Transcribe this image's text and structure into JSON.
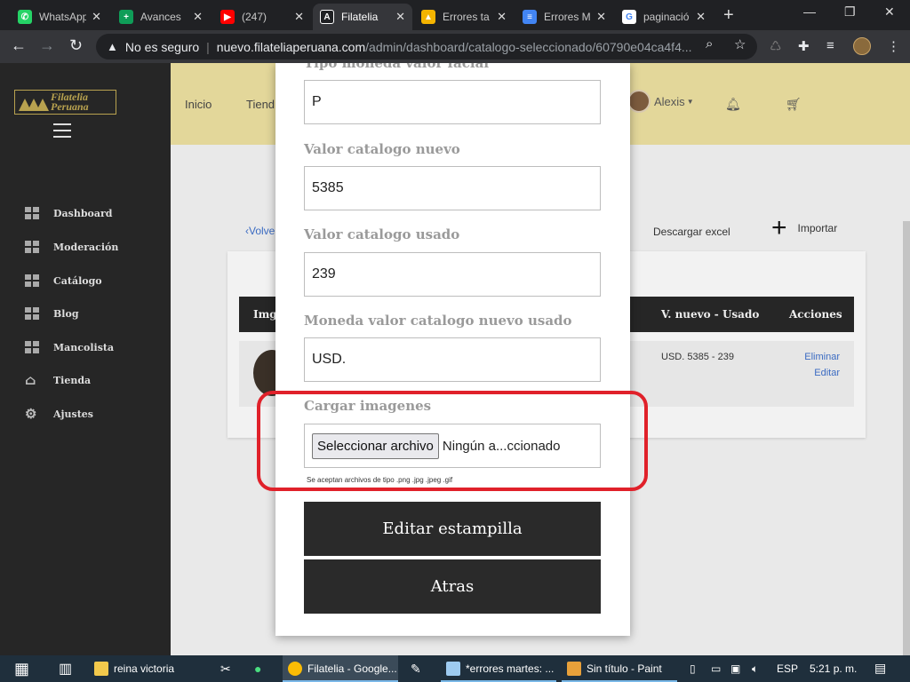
{
  "browser": {
    "tabs": [
      {
        "title": "WhatsApp",
        "favicon": "whatsapp-icon",
        "color": "#25d366"
      },
      {
        "title": "Avances",
        "favicon": "sheets-icon",
        "color": "#0f9d58"
      },
      {
        "title": "(247)",
        "favicon": "youtube-icon",
        "color": "#ff0000"
      },
      {
        "title": "Filatelia",
        "favicon": "site-a-icon",
        "color": "#202124"
      },
      {
        "title": "Errores ta",
        "favicon": "drive-icon",
        "color": "#f4b400"
      },
      {
        "title": "Errores M",
        "favicon": "docs-icon",
        "color": "#4285f4"
      },
      {
        "title": "paginació",
        "favicon": "google-icon",
        "color": "#4285f4"
      }
    ],
    "security_label": "No es seguro",
    "url_host": "nuevo.filateliaperuana.com",
    "url_path": "/admin/dashboard/catalogo-seleccionado/60790e04ca4f4..."
  },
  "app": {
    "logo_line1": "Filatelia",
    "logo_line2": "Peruana",
    "nav": [
      "Inicio",
      "Tiend"
    ],
    "user_name": "Alexis",
    "sidebar": [
      {
        "label": "Dashboard",
        "icon": "grid-icon"
      },
      {
        "label": "Moderación",
        "icon": "grid-icon"
      },
      {
        "label": "Catálogo",
        "icon": "grid-icon"
      },
      {
        "label": "Blog",
        "icon": "grid-icon"
      },
      {
        "label": "Mancolista",
        "icon": "grid-icon"
      },
      {
        "label": "Tienda",
        "icon": "store-icon"
      },
      {
        "label": "Ajustes",
        "icon": "gear-icon"
      }
    ],
    "back_label": "‹Volve",
    "download_excel": "Descargar excel",
    "import_label": "Importar",
    "table": {
      "headers": [
        "Img",
        "V. nuevo - Usado",
        "Acciones"
      ],
      "row": {
        "value": "USD. 5385 - 239",
        "delete": "Eliminar",
        "edit": "Editar"
      }
    }
  },
  "modal": {
    "label_tipo_moneda": "Tipo moneda valor facial",
    "tipo_moneda": "P",
    "label_valor_nuevo": "Valor catalogo nuevo",
    "valor_nuevo": "5385",
    "label_valor_usado": "Valor catalogo usado",
    "valor_usado": "239",
    "label_moneda_valor": "Moneda valor catalogo nuevo usado",
    "moneda_valor": "USD.",
    "label_cargar": "Cargar imagenes",
    "file_button": "Seleccionar archivo",
    "file_status": "Ningún a...ccionado",
    "file_hint": "Se aceptan archivos de tipo .png .jpg .jpeg .gif",
    "submit": "Editar estampilla",
    "back": "Atras"
  },
  "taskbar": {
    "items": [
      "reina victoria",
      "Filatelia - Google...",
      "*errores martes: ...",
      "Sin título - Paint"
    ],
    "lang": "ESP",
    "time": "5:21 p. m."
  }
}
